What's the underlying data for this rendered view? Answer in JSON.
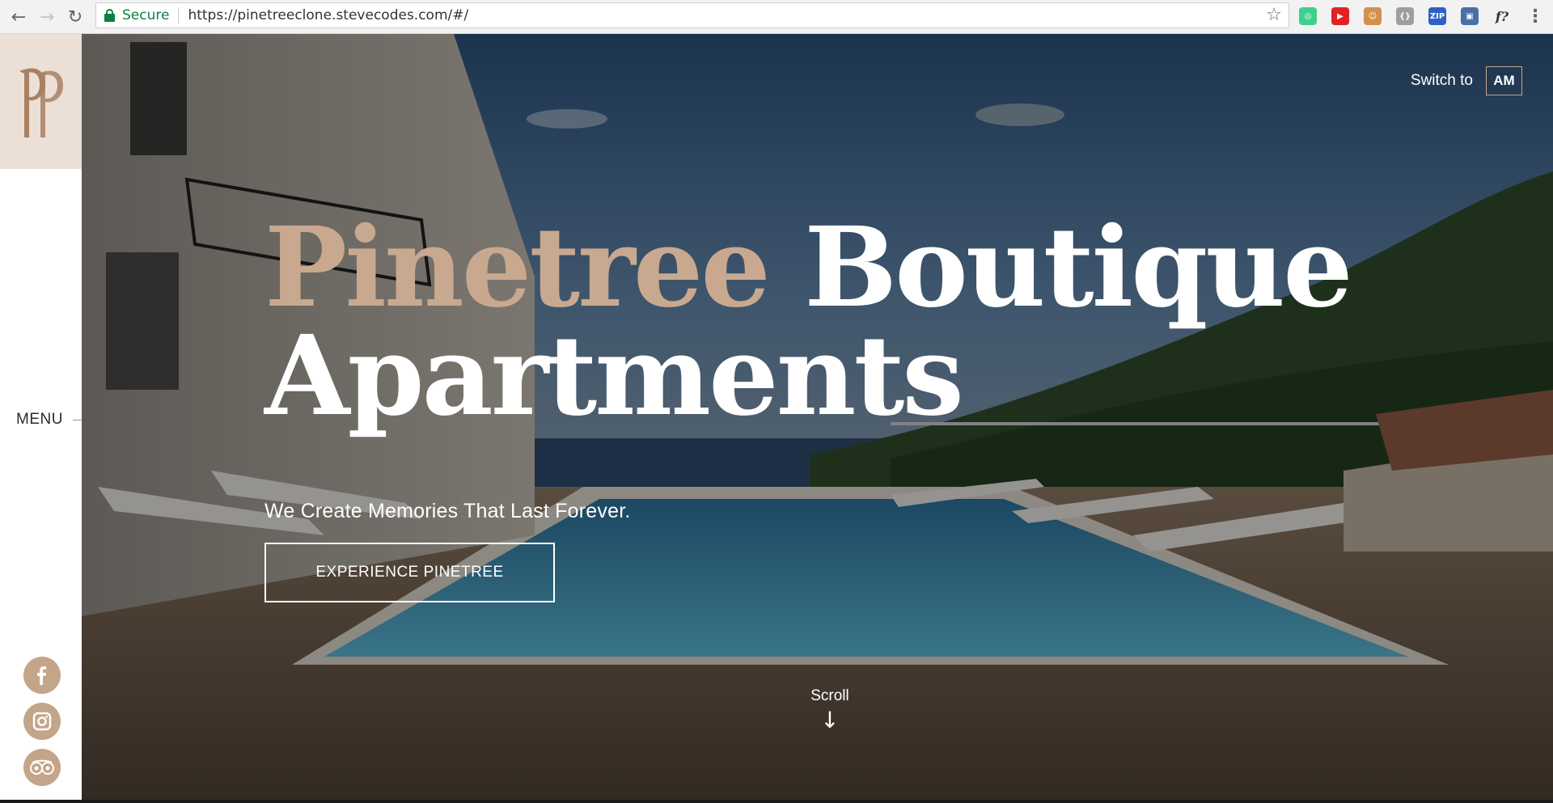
{
  "browser": {
    "back_icon": "←",
    "forward_icon": "→",
    "reload_icon": "↻",
    "secure_label": "Secure",
    "url": "https://pinetreeclone.stevecodes.com/#/",
    "star_icon": "☆",
    "menu_icon": "⋮",
    "extensions": [
      {
        "name": "grammarly-extension-icon",
        "glyph": "◎",
        "color": "#3ecf8e"
      },
      {
        "name": "youtube-extension-icon",
        "glyph": "▶",
        "color": "#e02222"
      },
      {
        "name": "face-extension-icon",
        "glyph": "☺",
        "color": "#d2904a"
      },
      {
        "name": "code-extension-icon",
        "glyph": "{}",
        "color": "#9e9e9e"
      },
      {
        "name": "zip-extension-icon",
        "glyph": "ZIP",
        "color": "#2d61c4"
      },
      {
        "name": "screenshot-extension-icon",
        "glyph": "▣",
        "color": "#4a6fa5"
      },
      {
        "name": "whatfont-extension-icon",
        "glyph": "f?",
        "color": "#333333"
      }
    ]
  },
  "sidebar": {
    "menu_label": "MENU",
    "social": [
      {
        "name": "facebook-icon"
      },
      {
        "name": "instagram-icon"
      },
      {
        "name": "tripadvisor-icon"
      }
    ]
  },
  "hero": {
    "switch_label": "Switch to",
    "switch_button": "AM",
    "headline_accent": "Pinetree",
    "headline_rest": " Boutique Apartments",
    "tagline": "We Create Memories That Last Forever.",
    "cta_label": "EXPERIENCE PINETREE",
    "scroll_label": "Scroll",
    "scroll_arrow": "↓"
  },
  "colors": {
    "accent": "#c8a98f",
    "logo_bg": "#ecdfd5",
    "secure_green": "#0b8043"
  }
}
